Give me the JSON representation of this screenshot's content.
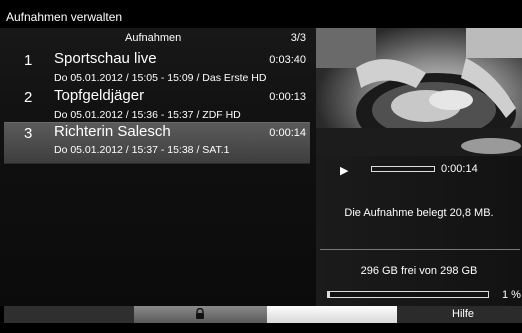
{
  "window": {
    "title": "Aufnahmen verwalten"
  },
  "list": {
    "header": "Aufnahmen",
    "count": "3/3",
    "items": [
      {
        "num": "1",
        "name": "Sportschau live",
        "duration": "0:03:40",
        "info": "Do 05.01.2012  / 15:05 - 15:09  / Das Erste HD",
        "selected": false
      },
      {
        "num": "2",
        "name": "Topfgeldjäger",
        "duration": "0:00:13",
        "info": "Do 05.01.2012  / 15:36 - 15:37  / ZDF HD",
        "selected": false
      },
      {
        "num": "3",
        "name": "Richterin Salesch",
        "duration": "0:00:14",
        "info": "Do 05.01.2012  / 15:37 - 15:38  / SAT.1",
        "selected": true
      }
    ]
  },
  "player": {
    "play_icon": "play-icon",
    "time": "0:00:14",
    "progress": 0
  },
  "details": {
    "size_text": "Die Aufnahme belegt 20,8 MB."
  },
  "disk": {
    "free_text": "296 GB frei von 298 GB",
    "percent_text": "1 %",
    "used_fraction": 0.01
  },
  "footer": {
    "buttons": [
      {
        "color": "red",
        "label": ""
      },
      {
        "color": "green",
        "icon": "lock-icon",
        "label": ""
      },
      {
        "color": "yellow",
        "label": ""
      },
      {
        "color": "blue",
        "label": "Hilfe"
      }
    ]
  },
  "colors": {
    "selected_row": "#505050",
    "footer_green": "#7a7a7a",
    "footer_yellow": "#f0f0f0"
  }
}
